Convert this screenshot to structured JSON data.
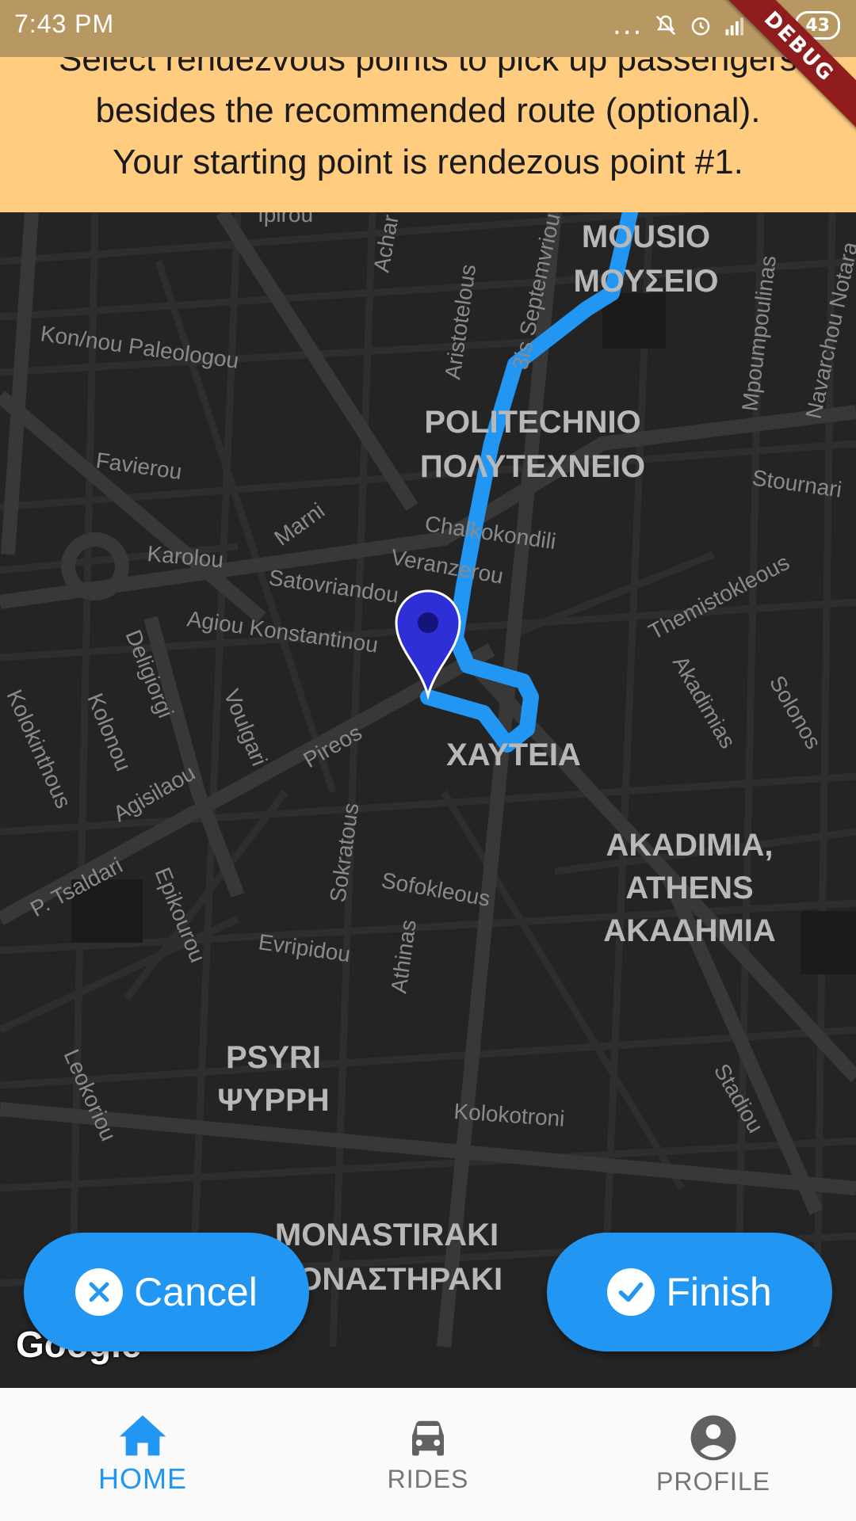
{
  "status_bar": {
    "time": "7:43 PM",
    "overflow_dots": "...",
    "battery": "43"
  },
  "debug_banner": "DEBUG",
  "banner": {
    "line1": "Select rendezvous points to pick up passengers",
    "line2": "besides the recommended route (optional).",
    "line3": "Your starting point is rendezous point #1.",
    "background": "#ffcc80"
  },
  "map": {
    "streets": [
      "Ipirou",
      "Achar",
      "Aristotelous",
      "3is Septemvriou",
      "Mpoumpoulinas",
      "Navarchou Notara",
      "Kon/nou Paleologou",
      "Favierou",
      "Marni",
      "Chalkokondili",
      "Veranzerou",
      "Stournari",
      "Karolou",
      "Satovriandou",
      "Agiou Konstantinou",
      "Themistokleous",
      "Deligiorgi",
      "Kolonou",
      "Voulgari",
      "Akadimias",
      "Solonos",
      "Kolokinthous",
      "Agisilaou",
      "Pireos",
      "P. Tsaldari",
      "Epikourou",
      "Sokratous",
      "Sofokleous",
      "Athinas",
      "Evripidou",
      "Leokoriou",
      "Kolokotroni",
      "Stadiou"
    ],
    "areas": {
      "mousio_latin": "MOUSIO",
      "mousio_greek": "ΜΟΥΣΕΙΟ",
      "politechnio_latin": "POLITECHNIO",
      "politechnio_greek": "ΠΟΛΥΤΕΧΝΕΙΟ",
      "chafteia_greek": "ΧΑΥΤΕΙΑ",
      "akadimia_1": "AKADIMIA,",
      "akadimia_2": "ATHENS",
      "akadimia_greek": "ΑΚΑΔΗΜΙΑ",
      "psyri_latin": "PSYRI",
      "psyri_greek": "ΨΥΡΡΗ",
      "monastiraki_latin": "MONASTIRAKI",
      "monastiraki_greek": "ΜΟΝΑΣΤΗΡΑΚΙ"
    },
    "route_color": "#2196f3",
    "marker_color": "#2f2fd8",
    "attribution": "Google"
  },
  "actions": {
    "cancel_label": "Cancel",
    "finish_label": "Finish",
    "button_color": "#2196f3"
  },
  "bottom_nav": {
    "items": [
      {
        "label": "HOME",
        "icon": "home-icon",
        "active": true
      },
      {
        "label": "RIDES",
        "icon": "car-icon",
        "active": false
      },
      {
        "label": "PROFILE",
        "icon": "account-circle-icon",
        "active": false
      }
    ]
  }
}
